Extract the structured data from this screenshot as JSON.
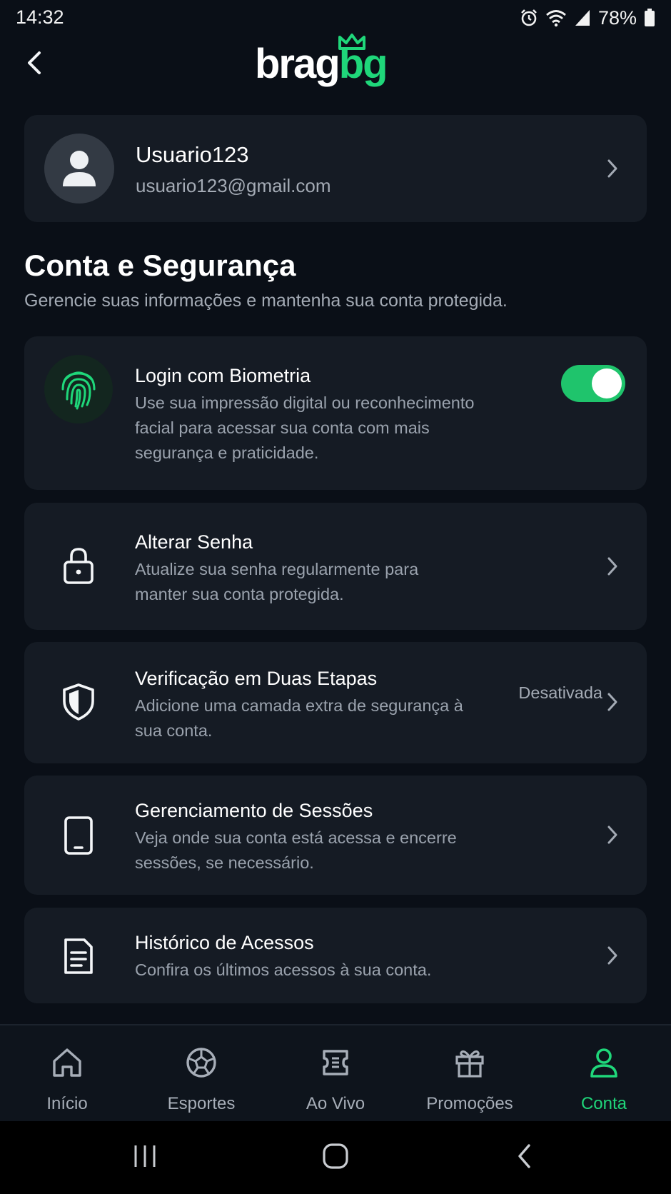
{
  "status_bar": {
    "time": "14:32",
    "battery": "78%",
    "icons": [
      "alarm-icon",
      "wifi-icon",
      "signal-icon",
      "battery-icon"
    ]
  },
  "header": {
    "back_icon": "back-arrow-icon",
    "logo_part1": "brag",
    "logo_part2": "bg",
    "logo_crown_icon": "crown-icon"
  },
  "profile": {
    "username": "Usuario123",
    "email": "usuario123@gmail.com"
  },
  "section": {
    "title": "Conta e Segurança",
    "subtitle": "Gerencie suas informações e mantenha sua conta protegida."
  },
  "settings": [
    {
      "title": "Login com Biometria",
      "description": "Use sua impressão digital ou reconhecimento facial para acessar sua conta com mais segurança e praticidade.",
      "icon": "fingerprint-icon",
      "toggle_on": true
    },
    {
      "title": "Alterar Senha",
      "description": "Atualize sua senha regularmente para manter sua conta protegida.",
      "icon": "lock-icon"
    },
    {
      "title": "Verificação em Duas Etapas",
      "description": "Adicione uma camada extra de segurança à sua conta.",
      "status": "Desativada",
      "icon": "shield-icon"
    },
    {
      "title": "Gerenciamento de Sessões",
      "description": "Veja onde sua conta está acessa e encerre sessões, se necessário.",
      "icon": "phone-icon"
    },
    {
      "title": "Histórico de Acessos",
      "description": "Confira os últimos acessos à sua conta.",
      "icon": "document-icon"
    }
  ],
  "bottom_nav": [
    {
      "label": "Início",
      "icon": "home-icon"
    },
    {
      "label": "Esportes",
      "icon": "soccer-ball-icon"
    },
    {
      "label": "Ao Vivo",
      "icon": "ticket-icon"
    },
    {
      "label": "Promoções",
      "icon": "gift-icon"
    },
    {
      "label": "Conta",
      "icon": "user-icon",
      "active": true
    }
  ],
  "colors": {
    "background": "#0a0f17",
    "card": "#151b24",
    "accent": "#1fd77a",
    "toggle": "#1fc46c",
    "muted_text": "#9aa2ad"
  }
}
